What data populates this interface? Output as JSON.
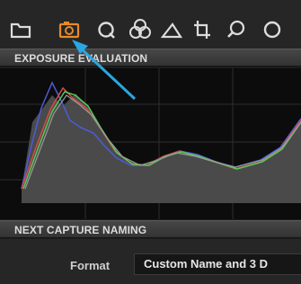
{
  "toolbar": {
    "tools": [
      {
        "icon": "folder-icon",
        "active": false
      },
      {
        "icon": "camera-icon",
        "active": true
      },
      {
        "icon": "lens-icon",
        "active": false
      },
      {
        "icon": "color-circles-icon",
        "active": false
      },
      {
        "icon": "exposure-triangle-icon",
        "active": false
      },
      {
        "icon": "crop-icon",
        "active": false
      },
      {
        "icon": "search-icon",
        "active": false
      }
    ],
    "active_color": "#e88a2c",
    "icon_color": "#dcdcdc"
  },
  "exposure": {
    "title": "EXPOSURE EVALUATION"
  },
  "naming": {
    "title": "NEXT CAPTURE NAMING",
    "format_label": "Format",
    "format_value": "Custom Name and 3 D"
  },
  "annotation": {
    "arrow_color": "#2aa6e0",
    "points_to": "camera-icon"
  }
}
